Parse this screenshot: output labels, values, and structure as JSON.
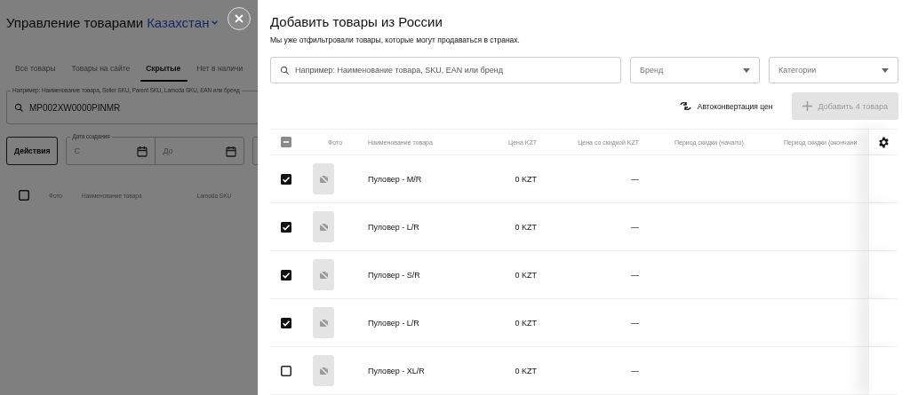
{
  "background_page": {
    "title": "Управление товарами",
    "region": "Казахстан",
    "tabs": [
      {
        "label": "Все товары",
        "selected": false
      },
      {
        "label": "Товары на сайте",
        "selected": false
      },
      {
        "label": "Скрытые",
        "selected": true
      },
      {
        "label": "Нет в наличи",
        "selected": false
      }
    ],
    "search": {
      "label": "Например: Наименование товара, Seller SKU, Parent SKU, Lamoda SKU, EAN или бренд",
      "value": "MP002XW0000PINMR"
    },
    "actions_button": "Действия",
    "date_field": {
      "label": "Дата создания",
      "from_placeholder": "С",
      "to_placeholder": "До"
    },
    "select_all": {
      "checked": false
    },
    "columns": [
      "Фото",
      "Наименование товара",
      "Lamoda SKU"
    ]
  },
  "panel": {
    "title": "Добавить товары из России",
    "subtitle": "Мы уже отфильтровали товары, которые могут продаваться в странах.",
    "search": {
      "placeholder": "Например: Наименование товара, SKU, EAN или бренд"
    },
    "brand": {
      "placeholder": "Бренд"
    },
    "categories": {
      "placeholder": "Категории"
    },
    "autoconvert_button": "Автоконвертация цен",
    "add_button": {
      "label": "Добавить 4 товара",
      "disabled": true
    },
    "select_all": {
      "checked": false,
      "partial": true
    },
    "columns": [
      "Фото",
      "Наименование товара",
      "Цена KZT",
      "Цена со скидкой KZT",
      "Период скидки (начало)",
      "Период скидки (окончани"
    ],
    "rows": [
      {
        "checked": true,
        "name": "Пуловер - M/R",
        "price": "0 KZT",
        "discount_price": "—"
      },
      {
        "checked": true,
        "name": "Пуловер - L/R",
        "price": "0 KZT",
        "discount_price": "—"
      },
      {
        "checked": true,
        "name": "Пуловер - S/R",
        "price": "0 KZT",
        "discount_price": "—"
      },
      {
        "checked": true,
        "name": "Пуловер - L/R",
        "price": "0 KZT",
        "discount_price": "—"
      },
      {
        "checked": false,
        "name": "Пуловер - XL/R",
        "price": "0 KZT",
        "discount_price": "—"
      }
    ]
  }
}
